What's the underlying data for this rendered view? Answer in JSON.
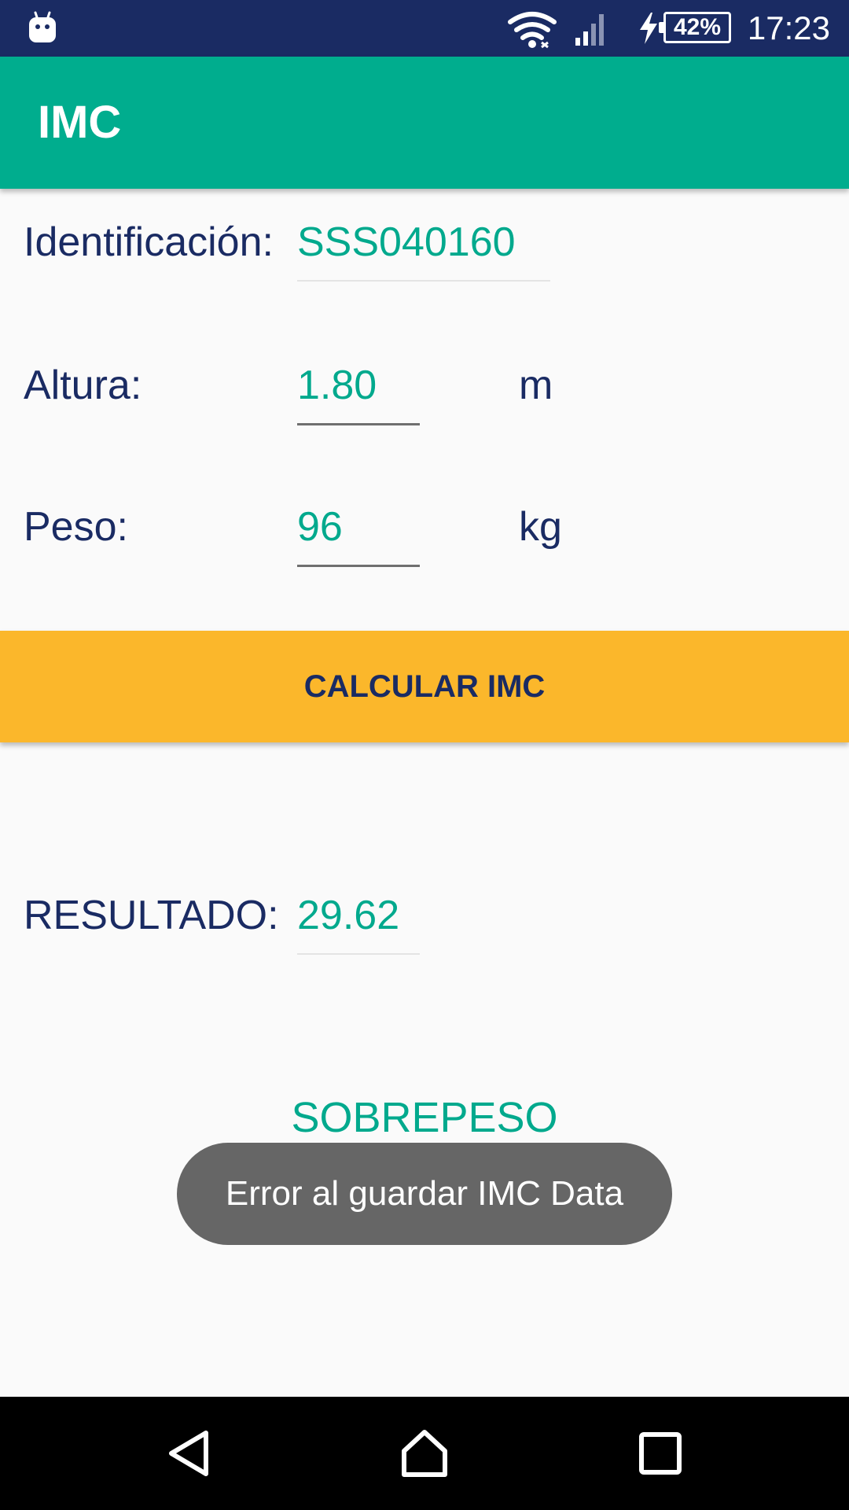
{
  "status_bar": {
    "time": "17:23",
    "battery": "42%",
    "icons": [
      "android-icon",
      "wifi-icon",
      "signal-icon",
      "charging-icon",
      "battery-icon"
    ],
    "background": "#1a2b63"
  },
  "app_bar": {
    "title": "IMC",
    "background": "#00ad8e"
  },
  "form": {
    "identification": {
      "label": "Identificación:",
      "value": "SSS040160"
    },
    "height": {
      "label": "Altura:",
      "value": "1.80",
      "unit": "m"
    },
    "weight": {
      "label": "Peso:",
      "value": "96",
      "unit": "kg"
    }
  },
  "calculate_button": {
    "label": "CALCULAR IMC",
    "background": "#fbb72b"
  },
  "result": {
    "label": "RESULTADO:",
    "value": "29.62",
    "category": "SOBREPESO"
  },
  "toast": {
    "message": "Error al guardar IMC Data"
  },
  "nav_bar": {
    "icons": [
      "back-icon",
      "home-icon",
      "recents-icon"
    ]
  },
  "colors": {
    "accent": "#00a98d",
    "text_primary": "#1a2b63",
    "background": "#fafafa"
  }
}
